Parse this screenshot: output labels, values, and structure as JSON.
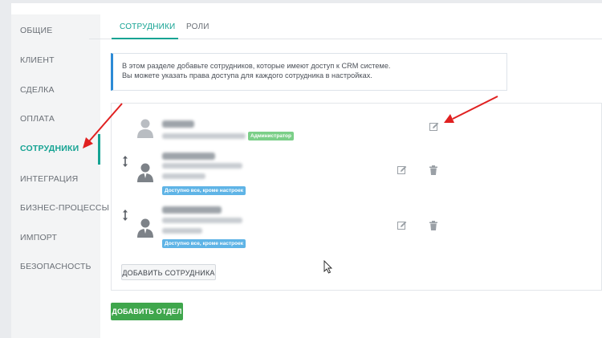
{
  "sidebar": {
    "items": [
      {
        "label": "ОБЩИЕ"
      },
      {
        "label": "КЛИЕНТ"
      },
      {
        "label": "СДЕЛКА"
      },
      {
        "label": "ОПЛАТА"
      },
      {
        "label": "СОТРУДНИКИ",
        "active": true
      },
      {
        "label": "ИНТЕГРАЦИЯ"
      },
      {
        "label": "БИЗНЕС-ПРОЦЕССЫ"
      },
      {
        "label": "ИМПОРТ"
      },
      {
        "label": "БЕЗОПАСНОСТЬ"
      }
    ]
  },
  "tabs": [
    {
      "label": "СОТРУДНИКИ",
      "active": true
    },
    {
      "label": "РОЛИ"
    }
  ],
  "info": {
    "line1": "В этом разделе добавьте сотрудников, которые имеют доступ к CRM системе.",
    "line2": "Вы можете указать права доступа для каждого сотрудника в настройках."
  },
  "employees": [
    {
      "badge": "Администратор",
      "badge_type": "admin",
      "actions": [
        "edit-icon"
      ]
    },
    {
      "badge": "Доступно все, кроме настроек",
      "badge_type": "perm",
      "actions": [
        "edit-icon",
        "trash-icon"
      ]
    },
    {
      "badge": "Доступно все, кроме настроек",
      "badge_type": "perm",
      "actions": [
        "edit-icon",
        "trash-icon"
      ]
    }
  ],
  "buttons": {
    "add_employee": "ДОБАВИТЬ СОТРУДНИКА",
    "add_department": "ДОБАВИТЬ ОТДЕЛ"
  },
  "colors": {
    "accent": "#15a393",
    "admin_badge": "#7bcf88",
    "permission_badge": "#5fb4e6",
    "primary_button": "#3fa64c",
    "annotation_arrow": "#e02020"
  }
}
